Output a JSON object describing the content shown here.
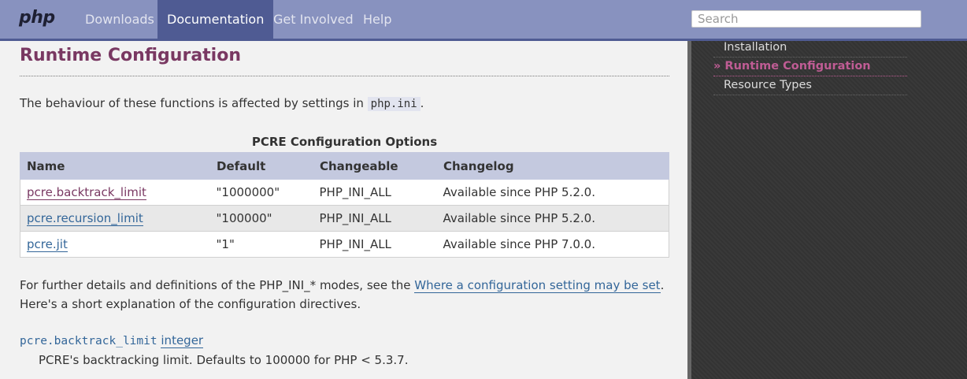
{
  "nav": {
    "logo": "php",
    "items": [
      {
        "label": "Downloads",
        "active": false
      },
      {
        "label": "Documentation",
        "active": true
      },
      {
        "label": "Get Involved",
        "active": false
      },
      {
        "label": "Help",
        "active": false
      }
    ],
    "search_placeholder": "Search"
  },
  "main": {
    "title": "Runtime Configuration",
    "intro_prefix": "The behaviour of these functions is affected by settings in ",
    "intro_code": "php.ini",
    "intro_suffix": ".",
    "table": {
      "caption": "PCRE Configuration Options",
      "headers": [
        "Name",
        "Default",
        "Changeable",
        "Changelog"
      ],
      "rows": [
        {
          "name": "pcre.backtrack_limit",
          "default": "\"1000000\"",
          "changeable": "PHP_INI_ALL",
          "changelog": "Available since PHP 5.2.0."
        },
        {
          "name": "pcre.recursion_limit",
          "default": "\"100000\"",
          "changeable": "PHP_INI_ALL",
          "changelog": "Available since PHP 5.2.0."
        },
        {
          "name": "pcre.jit",
          "default": "\"1\"",
          "changeable": "PHP_INI_ALL",
          "changelog": "Available since PHP 7.0.0."
        }
      ]
    },
    "further_prefix": "For further details and definitions of the PHP_INI_* modes, see the ",
    "further_link": "Where a configuration setting may be set",
    "further_suffix": ".",
    "explanation": "Here's a short explanation of the configuration directives.",
    "directive": {
      "name": "pcre.backtrack_limit",
      "type": "integer",
      "description": "PCRE's backtracking limit. Defaults to 100000 for PHP < 5.3.7."
    }
  },
  "sidebar": {
    "items": [
      {
        "label": "Installation",
        "current": false
      },
      {
        "label": "» Runtime Configuration",
        "current": true
      },
      {
        "label": "Resource Types",
        "current": false
      }
    ]
  },
  "colors": {
    "nav_bg": "#8892bf",
    "nav_active": "#4f5b93",
    "title": "#793862",
    "link": "#336699",
    "sidebar_current": "#bf5c94"
  }
}
